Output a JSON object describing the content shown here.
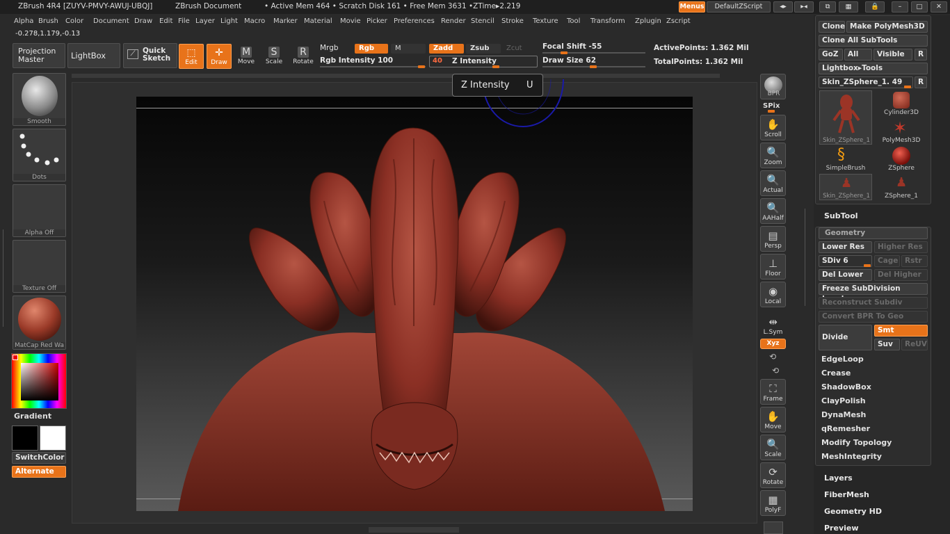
{
  "title_bar": {
    "app": "ZBrush 4R4 [ZUYV-PMVY-AWUJ-UBQJ]",
    "document": "ZBrush Document",
    "stats": "• Active Mem 464 • Scratch Disk 161 • Free Mem 3631 •ZTime▸2.219",
    "menus_button": "Menus",
    "script_button": "DefaultZScript"
  },
  "menu_bar": [
    "Alpha",
    "Brush",
    "Color",
    "Document",
    "Draw",
    "Edit",
    "File",
    "Layer",
    "Light",
    "Macro",
    "Marker",
    "Material",
    "Movie",
    "Picker",
    "Preferences",
    "Render",
    "Stencil",
    "Stroke",
    "Texture",
    "Tool",
    "Transform",
    "Zplugin",
    "Zscript"
  ],
  "coords": "-0.278,1.179,-0.13",
  "top_shelf": {
    "projection_master": "Projection Master",
    "lightbox": "LightBox",
    "quick_sketch": "Quick Sketch",
    "edit": "Edit",
    "draw": "Draw",
    "move": "Move",
    "scale": "Scale",
    "rotate": "Rotate",
    "mrgb": "Mrgb",
    "rgb": "Rgb",
    "m": "M",
    "zadd": "Zadd",
    "zsub": "Zsub",
    "zcut": "Zcut",
    "rgb_intensity": "Rgb Intensity 100",
    "z_intensity_value": "40",
    "z_intensity": "Z Intensity",
    "focal_shift": "Focal Shift -55",
    "draw_size": "Draw Size 62",
    "active_points": "ActivePoints: 1.362 Mil",
    "total_points": "TotalPoints: 1.362 Mil"
  },
  "tooltip": {
    "label": "Z Intensity",
    "hotkey": "U"
  },
  "left_shelf": {
    "brush": "Smooth",
    "stroke": "Dots",
    "alpha": "Alpha Off",
    "texture": "Texture Off",
    "material": "MatCap Red Wa",
    "gradient": "Gradient",
    "switch_color": "SwitchColor",
    "alternate": "Alternate"
  },
  "right_shelf": [
    "BPR",
    "SPix",
    "Scroll",
    "Zoom",
    "Actual",
    "AAHalf",
    "Persp",
    "Floor",
    "Local",
    "L.Sym",
    "Xyz",
    "Frame",
    "Move",
    "Scale",
    "Rotate",
    "PolyF"
  ],
  "palette": {
    "clone": "Clone",
    "make_polymesh": "Make PolyMesh3D",
    "clone_all": "Clone All SubTools",
    "goz": "GoZ",
    "all": "All",
    "visible": "Visible",
    "r": "R",
    "lightbox_tools": "Lightbox▸Tools",
    "current_tool": "Skin_ZSphere_1. 49",
    "tools": [
      "Skin_ZSphere_1",
      "Cylinder3D",
      "SimpleBrush",
      "PolyMesh3D",
      "ZSphere",
      "Skin_ZSphere_1",
      "ZSphere_1"
    ],
    "subtool": "SubTool",
    "geometry": "Geometry",
    "lower_res": "Lower Res",
    "higher_res": "Higher Res",
    "sdiv": "SDiv 6",
    "cage": "Cage",
    "rstr": "Rstr",
    "del_lower": "Del Lower",
    "del_higher": "Del Higher",
    "freeze": "Freeze SubDivision Levels",
    "reconstruct": "Reconstruct Subdiv",
    "convert_bpr": "Convert BPR To Geo",
    "divide": "Divide",
    "smt": "Smt",
    "suv": "Suv",
    "reuv": "ReUV",
    "geo_items": [
      "EdgeLoop",
      "Crease",
      "ShadowBox",
      "ClayPolish",
      "DynaMesh",
      "qRemesher",
      "Modify Topology",
      "MeshIntegrity"
    ],
    "layers": "Layers",
    "fibermesh": "FiberMesh",
    "geometry_hd": "Geometry HD",
    "preview": "Preview"
  },
  "colors": {
    "accent": "#e8731a",
    "clay": "#8a2f24"
  }
}
